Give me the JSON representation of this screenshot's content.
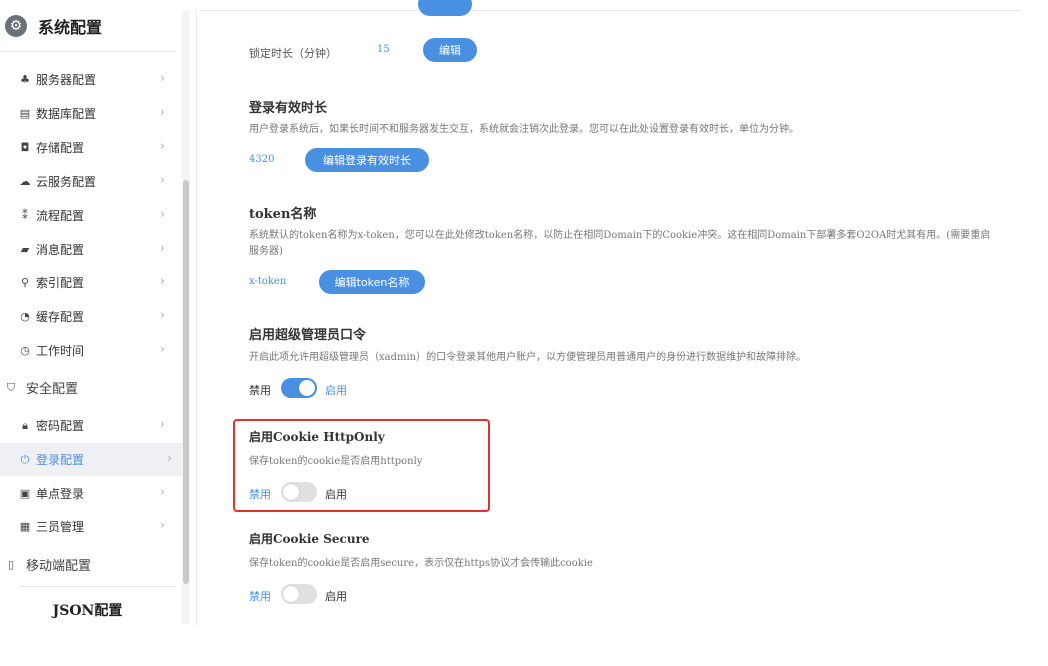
{
  "sidebar": {
    "title": "系统配置",
    "items": [
      {
        "label": "服务器配置",
        "icon": "server-icon"
      },
      {
        "label": "数据库配置",
        "icon": "database-icon"
      },
      {
        "label": "存储配置",
        "icon": "storage-icon"
      },
      {
        "label": "云服务配置",
        "icon": "cloud-icon"
      },
      {
        "label": "流程配置",
        "icon": "flow-icon"
      },
      {
        "label": "消息配置",
        "icon": "message-icon"
      },
      {
        "label": "索引配置",
        "icon": "search-icon"
      },
      {
        "label": "缓存配置",
        "icon": "cache-icon"
      },
      {
        "label": "工作时间",
        "icon": "clock-icon"
      }
    ],
    "security_group": "安全配置",
    "security_items": [
      {
        "label": "密码配置",
        "icon": "lock-icon"
      },
      {
        "label": "登录配置",
        "icon": "login-icon",
        "active": true
      },
      {
        "label": "单点登录",
        "icon": "sso-icon"
      },
      {
        "label": "三员管理",
        "icon": "admin-icon"
      }
    ],
    "mobile_group": "移动端配置",
    "footer": "JSON配置"
  },
  "main": {
    "lock_duration": {
      "label": "锁定时长（分钟）",
      "value": "15",
      "button": "编辑"
    },
    "login_expiry": {
      "title": "登录有效时长",
      "desc": "用户登录系统后，如果长时间不和服务器发生交互，系统就会注销次此登录。您可以在此处设置登录有效时长，单位为分钟。",
      "value": "4320",
      "button": "编辑登录有效时长"
    },
    "token_name": {
      "title": "token名称",
      "desc": "系统默认的token名称为x-token，您可以在此处修改token名称，以防止在相同Domain下的Cookie冲突。这在相同Domain下部署多套O2OA时尤其有用。(需要重启服务器)",
      "value": "x-token",
      "button": "编辑token名称"
    },
    "super_admin": {
      "title": "启用超级管理员口令",
      "desc": "开启此项允许用超级管理员（xadmin）的口令登录其他用户账户，以方便管理员用普通用户的身份进行数据维护和故障排除。",
      "off_label": "禁用",
      "on_label": "启用",
      "enabled": true
    },
    "cookie_httponly": {
      "title": "启用Cookie HttpOnly",
      "desc": "保存token的cookie是否启用httponly",
      "off_label": "禁用",
      "on_label": "启用",
      "enabled": false
    },
    "cookie_secure": {
      "title": "启用Cookie Secure",
      "desc": "保存token的cookie是否启用secure，表示仅在https协议才会传输此cookie",
      "off_label": "禁用",
      "on_label": "启用",
      "enabled": false
    }
  },
  "colors": {
    "accent": "#4a90e2",
    "highlight": "#e0332c"
  }
}
